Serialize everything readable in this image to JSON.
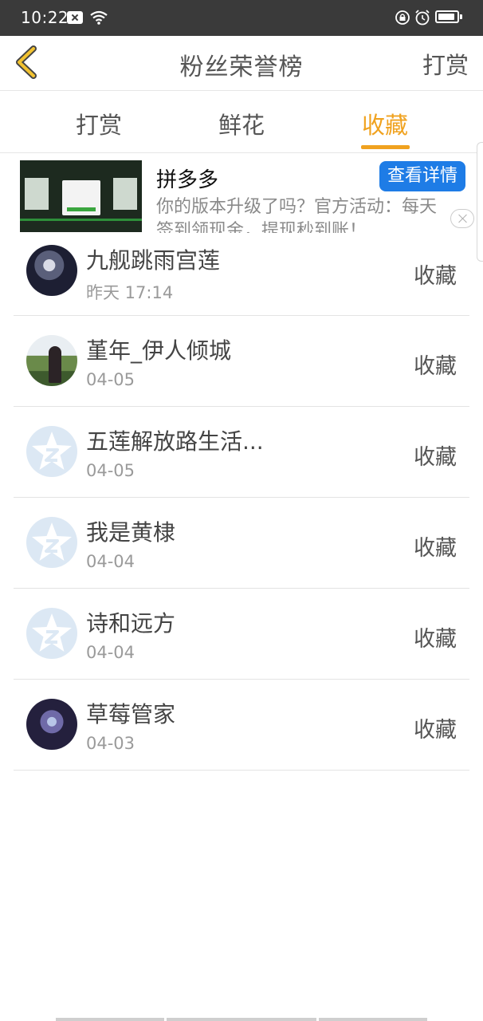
{
  "status_bar": {
    "time": "10:22"
  },
  "header": {
    "title": "粉丝荣誉榜",
    "right_action": "打赏"
  },
  "tabs": [
    {
      "label": "打赏",
      "active": false
    },
    {
      "label": "鲜花",
      "active": false
    },
    {
      "label": "收藏",
      "active": true
    }
  ],
  "colors": {
    "accent": "#f0a21f",
    "ad_button": "#1e7ce6",
    "default_avatar": "#dce8f4"
  },
  "ad": {
    "app_name": "拼多多",
    "button_label": "查看详情",
    "description_line1": "你的版本升级了吗？官方活动：每天",
    "description_line2": "签到领现金，提现秒到账！"
  },
  "list": [
    {
      "name": "九舰跳雨宫莲",
      "date": "昨天 17:14",
      "action": "收藏",
      "avatar": "photo"
    },
    {
      "name": "堇年_伊人倾城",
      "date": "04-05",
      "action": "收藏",
      "avatar": "photo"
    },
    {
      "name": "五莲解放路生活...",
      "date": "04-05",
      "action": "收藏",
      "avatar": "default-star-icon"
    },
    {
      "name": "我是黄棣",
      "date": "04-04",
      "action": "收藏",
      "avatar": "default-star-icon"
    },
    {
      "name": "诗和远方",
      "date": "04-04",
      "action": "收藏",
      "avatar": "default-star-icon"
    },
    {
      "name": "草莓管家",
      "date": "04-03",
      "action": "收藏",
      "avatar": "photo"
    }
  ]
}
